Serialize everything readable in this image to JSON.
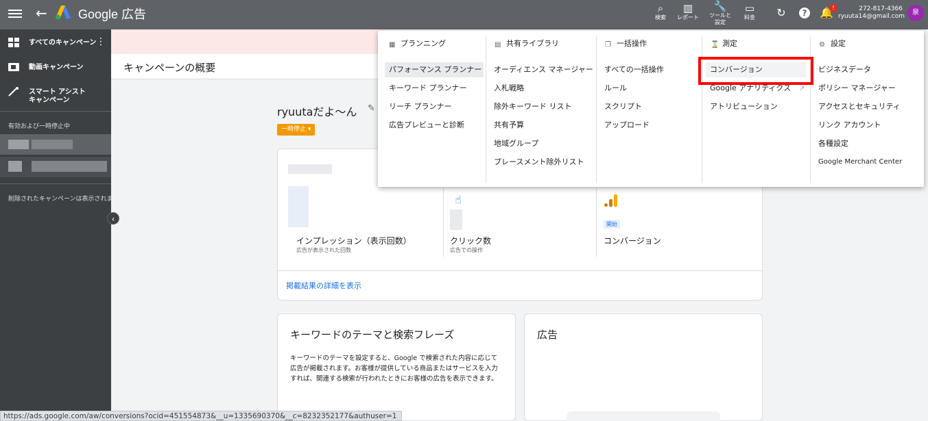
{
  "topbar": {
    "brand": "Google 広告",
    "tools": [
      {
        "icon": "search-icon",
        "label": "検索"
      },
      {
        "icon": "reports-icon",
        "label": "レポート"
      },
      {
        "icon": "wrench-icon",
        "label": "ツールと\n設定"
      },
      {
        "icon": "billing-icon",
        "label": "料金"
      }
    ],
    "notification_badge": "!",
    "account_id": "272-817-4366",
    "account_email": "ryuuta14@gmail.com",
    "avatar_initial": "泉"
  },
  "sidebar": {
    "items": [
      {
        "label": "すべてのキャンペーン"
      },
      {
        "label": "動画キャンペーン"
      },
      {
        "label": "スマート アシスト\nキャンペーン"
      }
    ],
    "section_label": "有効および一時停止中",
    "removed_note": "削除されたキャンペーンは表示されま"
  },
  "main": {
    "page_title": "キャンペーンの概要",
    "campaign_name": "ryuutaだよ〜ん",
    "status": "一時停止",
    "metrics": [
      {
        "label": "インプレッション（表示回数）",
        "sub": "広告が表示された回数"
      },
      {
        "label": "クリック数",
        "sub": "広告での操作"
      },
      {
        "label": "コンバージョン",
        "chip": "開始"
      }
    ],
    "details_link": "掲載結果の詳細を表示",
    "keyword_card": {
      "title": "キーワードのテーマと検索フレーズ",
      "text": "キーワードのテーマを設定すると、Google で検索された内容に応じて広告が掲載されます。お客様が提供している商品またはサービスを入力すれば、関連する検索が行われたときにお客様の広告を表示できます。"
    },
    "ads_card": {
      "title": "広告"
    }
  },
  "menu": {
    "columns": [
      {
        "header": "プランニング",
        "icon": "calendar-icon",
        "items": [
          "パフォーマンス プランナー",
          "キーワード プランナー",
          "リーチ プランナー",
          "広告プレビューと診断"
        ]
      },
      {
        "header": "共有ライブラリ",
        "icon": "library-icon",
        "items": [
          "オーディエンス マネージャー",
          "入札戦略",
          "除外キーワード リスト",
          "共有予算",
          "地域グループ",
          "プレースメント除外リスト"
        ]
      },
      {
        "header": "一括操作",
        "icon": "copy-icon",
        "items": [
          "すべての一括操作",
          "ルール",
          "スクリプト",
          "アップロード"
        ]
      },
      {
        "header": "測定",
        "icon": "hourglass-icon",
        "items": [
          "コンバージョン",
          "Google アナリティクス",
          "アトリビューション"
        ]
      },
      {
        "header": "設定",
        "icon": "gear-icon",
        "items": [
          "ビジネスデータ",
          "ポリシー マネージャー",
          "アクセスとセキュリティ",
          "リンク アカウント",
          "各種設定",
          "Google Merchant Center"
        ]
      }
    ]
  },
  "statusbar": {
    "url": "https://ads.google.com/aw/conversions?ocid=451554873&__u=1335690370&__c=8232352177&authuser=1"
  },
  "colors": {
    "topbar": "#5f6368",
    "sidebar": "#3c4043",
    "accent": "#1a73e8",
    "status_paused": "#f29900",
    "highlight_box": "#ff0000"
  }
}
